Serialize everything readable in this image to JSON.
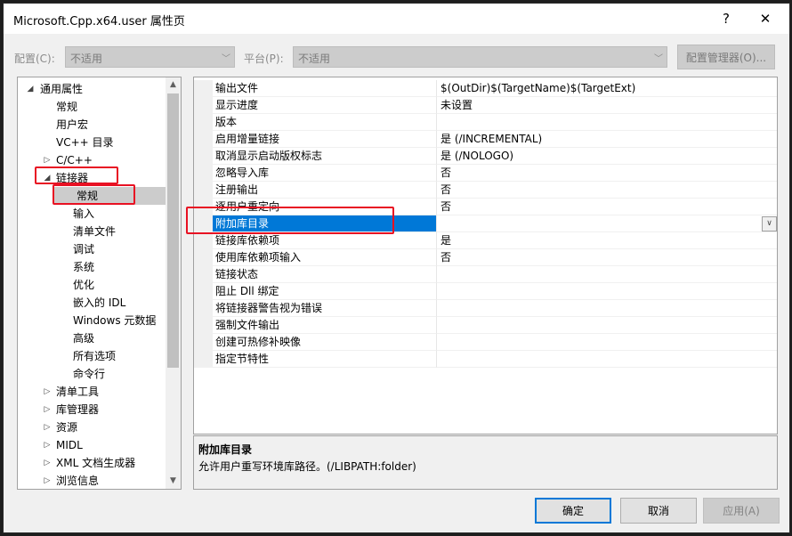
{
  "window": {
    "title": "Microsoft.Cpp.x64.user 属性页",
    "help_glyph": "?",
    "close_glyph": "✕"
  },
  "config": {
    "config_label": "配置(C):",
    "config_value": "不适用",
    "platform_label": "平台(P):",
    "platform_value": "不适用",
    "manager_button": "配置管理器(O)..."
  },
  "tree": {
    "items": [
      {
        "label": "通用属性",
        "expander": "◢"
      },
      {
        "label": "常规"
      },
      {
        "label": "用户宏"
      },
      {
        "label": "VC++ 目录"
      },
      {
        "label": "C/C++",
        "expander": "▷"
      },
      {
        "label": "链接器",
        "expander": "◢"
      },
      {
        "label": "常规"
      },
      {
        "label": "输入"
      },
      {
        "label": "清单文件"
      },
      {
        "label": "调试"
      },
      {
        "label": "系统"
      },
      {
        "label": "优化"
      },
      {
        "label": "嵌入的 IDL"
      },
      {
        "label": "Windows 元数据"
      },
      {
        "label": "高级"
      },
      {
        "label": "所有选项"
      },
      {
        "label": "命令行"
      },
      {
        "label": "清单工具",
        "expander": "▷"
      },
      {
        "label": "库管理器",
        "expander": "▷"
      },
      {
        "label": "资源",
        "expander": "▷"
      },
      {
        "label": "MIDL",
        "expander": "▷"
      },
      {
        "label": "XML 文档生成器",
        "expander": "▷"
      },
      {
        "label": "浏览信息",
        "expander": "▷"
      }
    ]
  },
  "properties": {
    "rows": [
      {
        "name": "输出文件",
        "value": "$(OutDir)$(TargetName)$(TargetExt)"
      },
      {
        "name": "显示进度",
        "value": "未设置"
      },
      {
        "name": "版本",
        "value": ""
      },
      {
        "name": "启用增量链接",
        "value": "是 (/INCREMENTAL)"
      },
      {
        "name": "取消显示启动版权标志",
        "value": "是 (/NOLOGO)"
      },
      {
        "name": "忽略导入库",
        "value": "否"
      },
      {
        "name": "注册输出",
        "value": "否"
      },
      {
        "name": "逐用户重定向",
        "value": "否"
      },
      {
        "name": "附加库目录",
        "value": ""
      },
      {
        "name": "链接库依赖项",
        "value": "是"
      },
      {
        "name": "使用库依赖项输入",
        "value": "否"
      },
      {
        "name": "链接状态",
        "value": ""
      },
      {
        "name": "阻止 Dll 绑定",
        "value": ""
      },
      {
        "name": "将链接器警告视为错误",
        "value": ""
      },
      {
        "name": "强制文件输出",
        "value": ""
      },
      {
        "name": "创建可热修补映像",
        "value": ""
      },
      {
        "name": "指定节特性",
        "value": ""
      }
    ]
  },
  "description": {
    "title": "附加库目录",
    "text": "允许用户重写环境库路径。(/LIBPATH:folder)"
  },
  "buttons": {
    "ok": "确定",
    "cancel": "取消",
    "apply": "应用(A)"
  },
  "colors": {
    "selection": "#0078d7",
    "annotation": "#e81123"
  }
}
